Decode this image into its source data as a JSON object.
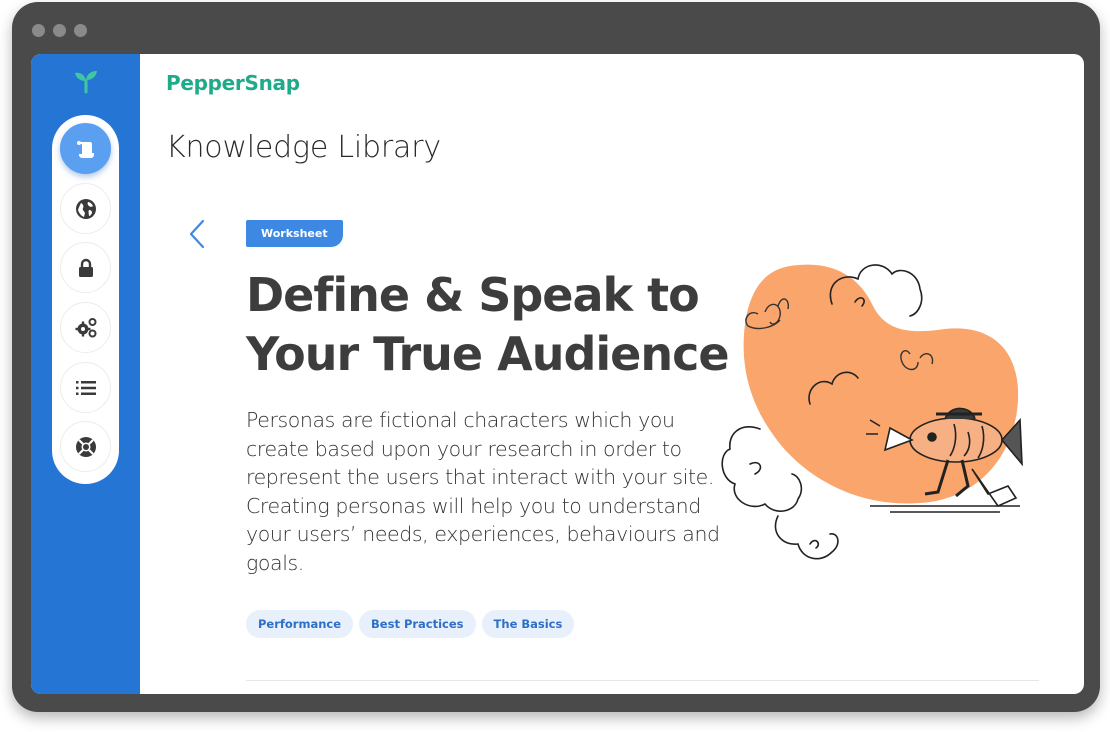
{
  "window": {
    "controls": [
      "close-dot",
      "minimize-dot",
      "maximize-dot"
    ]
  },
  "sidebar": {
    "logo_icon": "sprout-icon",
    "items": [
      {
        "name": "library",
        "icon": "scroll-icon",
        "active": true
      },
      {
        "name": "globe",
        "icon": "globe-icon",
        "active": false
      },
      {
        "name": "security",
        "icon": "lock-icon",
        "active": false
      },
      {
        "name": "settings",
        "icon": "gears-icon",
        "active": false
      },
      {
        "name": "list",
        "icon": "list-icon",
        "active": false
      },
      {
        "name": "support",
        "icon": "lifebuoy-icon",
        "active": false
      }
    ]
  },
  "header": {
    "brand": "PepperSnap",
    "page_title": "Knowledge Library"
  },
  "article": {
    "badge": "Worksheet",
    "title": "Define & Speak to Your True Audience",
    "description": "Personas are fictional characters which you create based upon your research in order to represent the users that interact with your site. Creating personas will help you to understand your users’ needs, experiences, behaviours and goals.",
    "tags": [
      "Performance",
      "Best Practices",
      "The Basics"
    ],
    "illustration": "fish-with-megaphone-illustration"
  },
  "colors": {
    "sidebar": "#2475d4",
    "active_nav": "#5b9ff0",
    "brand": "#1faa8a",
    "badge": "#3d88e3",
    "tag_bg": "#e7f0fb",
    "tag_text": "#2e6fc7",
    "blob": "#f9a56b",
    "frame": "#4a4a4a"
  }
}
